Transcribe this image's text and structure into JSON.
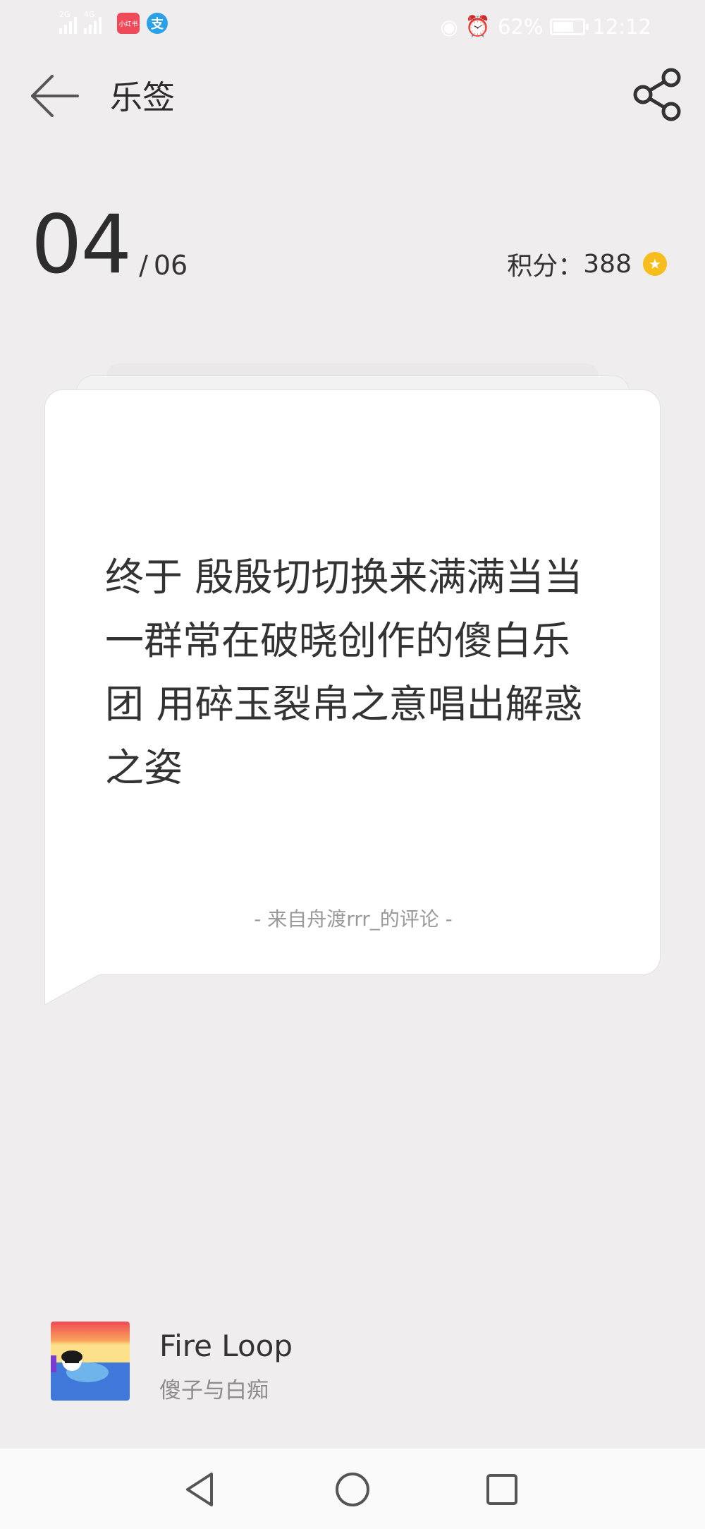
{
  "status_bar": {
    "signal_1_tag": "2G",
    "signal_2_tag": "4G",
    "app_badge_red": "小红书",
    "app_badge_blue": "支",
    "battery": "62%",
    "battery_level": 0.62,
    "time": "12:12"
  },
  "header": {
    "title": "乐签"
  },
  "counter": {
    "current": "04",
    "separator": "/",
    "total": "06"
  },
  "points": {
    "label": "积分：",
    "value": "388"
  },
  "card": {
    "quote": "终于 殷殷切切换来满满当当 一群常在破晓创作的傻白乐团 用碎玉裂帛之意唱出解惑之姿",
    "source": "- 来自舟渡rrr_的评论 -"
  },
  "song": {
    "title": "Fire Loop",
    "artist": "傻子与白痴"
  },
  "colors": {
    "background": "#efedee",
    "coin": "#f6bd1c",
    "text_primary": "#333333",
    "text_secondary": "#8c8c8c"
  }
}
